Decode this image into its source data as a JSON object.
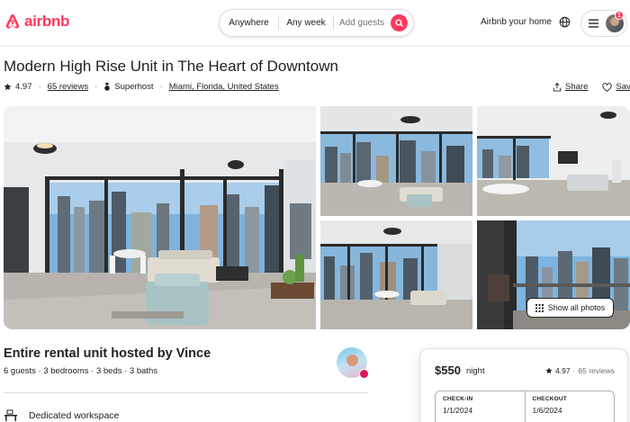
{
  "header": {
    "logo_text": "airbnb",
    "brand_color": "#FF385C",
    "search": {
      "where": "Anywhere",
      "when": "Any week",
      "guests_placeholder": "Add guests"
    },
    "host_link": "Airbnb your home",
    "notification_count": "1"
  },
  "listing": {
    "title": "Modern High Rise Unit in The Heart of Downtown",
    "rating": "4.97",
    "reviews": "65 reviews",
    "superhost": "Superhost",
    "location": "Miami, Florida, United States",
    "share_label": "Share",
    "save_label": "Save",
    "show_all_photos": "Show all photos",
    "host_title": "Entire rental unit hosted by Vince",
    "details": "6 guests · 3 bedrooms · 3 beds · 3 baths",
    "feature_1": "Dedicated workspace"
  },
  "booking": {
    "price": "$550",
    "price_unit": "night",
    "rating": "4.97",
    "reviews": "65 reviews",
    "checkin_label": "CHECK-IN",
    "checkin_value": "1/1/2024",
    "checkout_label": "CHECKOUT",
    "checkout_value": "1/6/2024"
  },
  "icons": {
    "logo": "airbnb-logo-icon",
    "search": "search-icon",
    "globe": "globe-icon",
    "menu": "hamburger-menu-icon",
    "star": "star-icon",
    "superhost": "superhost-medal-icon",
    "share": "share-icon",
    "save": "heart-icon",
    "grid": "grid-icon",
    "workspace": "desk-icon"
  }
}
